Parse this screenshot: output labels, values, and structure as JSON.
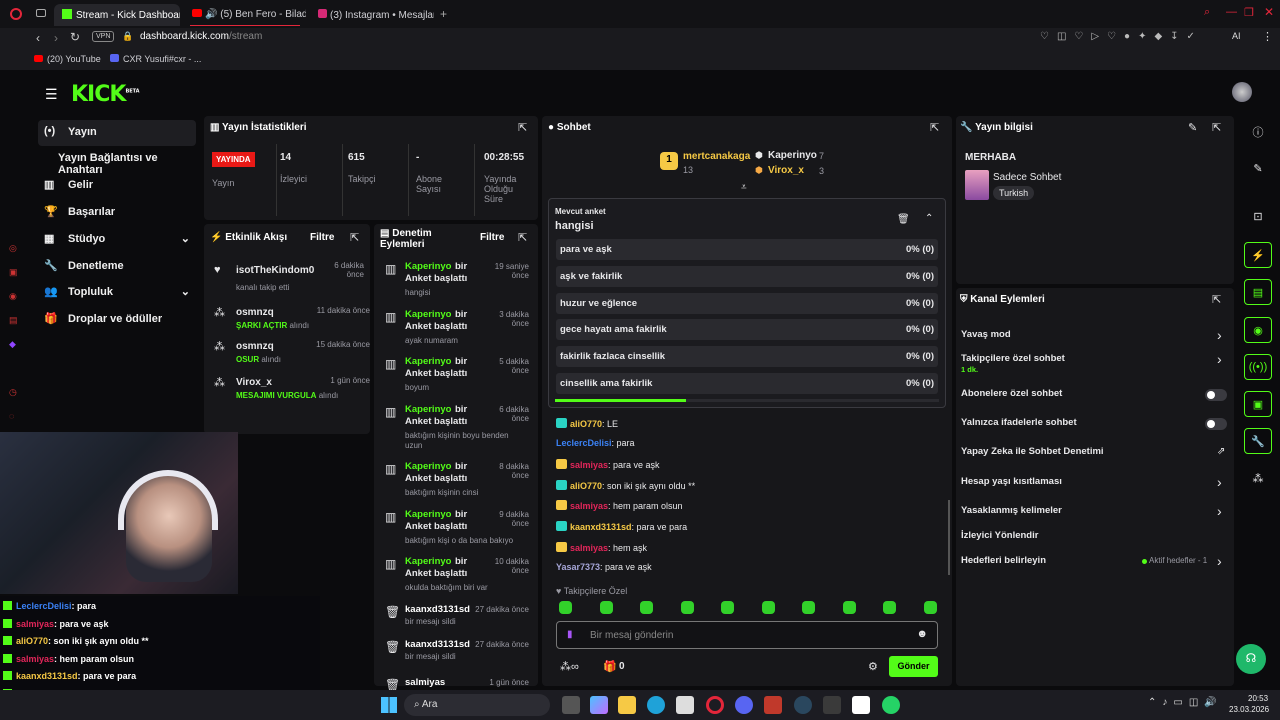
{
  "tabs": [
    {
      "label": "Stream - Kick Dashboard"
    },
    {
      "label": "(5) Ben Fero - Bilader"
    },
    {
      "label": "(3) Instagram • Mesajlar"
    }
  ],
  "address": {
    "domain": "dashboard.kick.com",
    "path": "/stream",
    "vpn": "VPN"
  },
  "bookmarks": [
    {
      "label": "(20) YouTube"
    },
    {
      "label": "CXR Yusufi#cxr - ..."
    }
  ],
  "logo": {
    "text": "KICK",
    "beta": "BETA"
  },
  "sidebar": {
    "items": [
      {
        "label": "Yayın"
      },
      {
        "label": "Yayın Bağlantısı ve Anahtarı"
      },
      {
        "label": "Gelir"
      },
      {
        "label": "Başarılar"
      },
      {
        "label": "Stüdyo"
      },
      {
        "label": "Denetleme"
      },
      {
        "label": "Topluluk"
      },
      {
        "label": "Droplar ve ödüller"
      }
    ]
  },
  "stats": {
    "title": "Yayın İstatistikleri",
    "live_badge": "YAYINDA",
    "live_label": "Yayın",
    "viewers": "14",
    "viewers_label": "İzleyici",
    "followers": "615",
    "followers_label": "Takipçi",
    "subs": "-",
    "subs_label": "Abone Sayısı",
    "uptime": "00:28:55",
    "uptime_label": "Yayında Olduğu Süre"
  },
  "activity": {
    "title": "Etkinlik Akışı",
    "filter": "Filtre",
    "items": [
      {
        "user": "isotTheKindom0",
        "time": "6 dakika önce",
        "detail": "kanalı takip etti",
        "highlight": ""
      },
      {
        "user": "osmnzq",
        "time": "11 dakika önce",
        "detail": "alındı",
        "highlight": "ŞARKI AÇTIR"
      },
      {
        "user": "osmnzq",
        "time": "15 dakika önce",
        "detail": "alındı",
        "highlight": "OSUR"
      },
      {
        "user": "Virox_x",
        "time": "1 gün önce",
        "detail": "alındı",
        "highlight": "MESAJIMI VURGULA"
      }
    ]
  },
  "moderation": {
    "title": "Denetim Eylemleri",
    "filter": "Filtre",
    "items": [
      {
        "user": "Kaperinyo",
        "action": "bir Anket başlattı",
        "time": "19 saniye önce",
        "detail": "hangisi"
      },
      {
        "user": "Kaperinyo",
        "action": "bir Anket başlattı",
        "time": "3 dakika önce",
        "detail": "ayak numaram"
      },
      {
        "user": "Kaperinyo",
        "action": "bir Anket başlattı",
        "time": "5 dakika önce",
        "detail": "boyum"
      },
      {
        "user": "Kaperinyo",
        "action": "bir Anket başlattı",
        "time": "6 dakika önce",
        "detail": "baktığım kişinin boyu benden uzun"
      },
      {
        "user": "Kaperinyo",
        "action": "bir Anket başlattı",
        "time": "8 dakika önce",
        "detail": "baktığım kişinin cinsi"
      },
      {
        "user": "Kaperinyo",
        "action": "bir Anket başlattı",
        "time": "9 dakika önce",
        "detail": "baktığım kişi o da bana bakıyo"
      },
      {
        "user": "Kaperinyo",
        "action": "bir Anket başlattı",
        "time": "10 dakika önce",
        "detail": "okulda baktığım biri var"
      },
      {
        "user": "kaanxd3131sd",
        "action": "",
        "time": "27 dakika önce",
        "detail": "bir mesajı sildi"
      },
      {
        "user": "kaanxd3131sd",
        "action": "",
        "time": "27 dakika önce",
        "detail": "bir mesajı sildi"
      },
      {
        "user": "salmiyas",
        "action": "",
        "time": "1 gün önce",
        "detail": ""
      }
    ]
  },
  "chat": {
    "title": "Sohbet",
    "top": [
      {
        "name": "mertcanakaga",
        "count": "13"
      },
      {
        "name": "Kaperinyo",
        "count": "7"
      },
      {
        "name": "Virox_x",
        "count": "3"
      }
    ],
    "poll": {
      "label": "Mevcut anket",
      "question": "hangisi",
      "options": [
        {
          "text": "para ve aşk",
          "pct": "0% (0)"
        },
        {
          "text": "aşk ve fakirlik",
          "pct": "0% (0)"
        },
        {
          "text": "huzur ve eğlence",
          "pct": "0% (0)"
        },
        {
          "text": "gece hayatı ama fakirlik",
          "pct": "0% (0)"
        },
        {
          "text": "fakirlik fazlaca cinsellik",
          "pct": "0% (0)"
        },
        {
          "text": "cinsellik ama fakirlik",
          "pct": "0% (0)"
        }
      ],
      "progress": 0.34
    },
    "messages": [
      {
        "user": "aliO770",
        "text": ": LE",
        "color": "#f6c945"
      },
      {
        "user": "LeclercDelisi",
        "text": ": para",
        "color": "#3b82f6"
      },
      {
        "user": "salmiyas",
        "text": ": para ve aşk",
        "color": "#e3265a"
      },
      {
        "user": "aliO770",
        "text": ": son iki şık aynı oldu **",
        "color": "#f6c945"
      },
      {
        "user": "salmiyas",
        "text": ": hem param olsun",
        "color": "#e3265a"
      },
      {
        "user": "kaanxd3131sd",
        "text": ": para ve para",
        "color": "#f6c945"
      },
      {
        "user": "salmiyas",
        "text": ": hem aşk",
        "color": "#e3265a"
      },
      {
        "user": "Yasar7373",
        "text": ": para ve aşk",
        "color": "#a6a6d8"
      }
    ],
    "followers_only": "Takipçilere Özel",
    "input_placeholder": "Bir mesaj gönderin",
    "points": "0",
    "send": "Gönder"
  },
  "stream_info": {
    "title": "Yayın bilgisi",
    "stream_title": "MERHABA",
    "category": "Sadece Sohbet",
    "language": "Turkish"
  },
  "channel_actions": {
    "title": "Kanal Eylemleri",
    "items": [
      {
        "label": "Yavaş mod",
        "sub": ""
      },
      {
        "label": "Takipçilere özel sohbet",
        "sub": "1 dk."
      },
      {
        "label": "Abonelere özel sohbet",
        "sub": ""
      },
      {
        "label": "Yalnızca ifadelerle sohbet",
        "sub": ""
      },
      {
        "label": "Yapay Zeka ile Sohbet Denetimi",
        "sub": ""
      },
      {
        "label": "Hesap yaşı kısıtlaması",
        "sub": ""
      },
      {
        "label": "Yasaklanmış kelimeler",
        "sub": ""
      },
      {
        "label": "İzleyici Yönlendir",
        "sub": ""
      },
      {
        "label": "Hedefleri belirleyin",
        "sub": ""
      }
    ],
    "goals_status": "Aktif hedefler - 1"
  },
  "overlay_chat": [
    {
      "user": "LeclercDelisi",
      "text": ": para",
      "color": "#3b82f6"
    },
    {
      "user": "salmiyas",
      "text": ": para ve aşk",
      "color": "#e3265a"
    },
    {
      "user": "aliO770",
      "text": ": son iki şık aynı oldu **",
      "color": "#f6c945"
    },
    {
      "user": "salmiyas",
      "text": ": hem param olsun",
      "color": "#e3265a"
    },
    {
      "user": "kaanxd3131sd",
      "text": ": para ve para",
      "color": "#f6c945"
    },
    {
      "user": "salmiyas",
      "text": ": hem aşk",
      "color": "#e3265a"
    },
    {
      "user": "Yasar7373",
      "text": ": para ve aşk",
      "color": "#a6a6d8"
    }
  ],
  "taskbar": {
    "search": "Ara",
    "time": "20:53",
    "date": "23.03.2026"
  },
  "colors": {
    "accent": "#53fc18",
    "live": "#e91916",
    "panel": "#17171a"
  }
}
